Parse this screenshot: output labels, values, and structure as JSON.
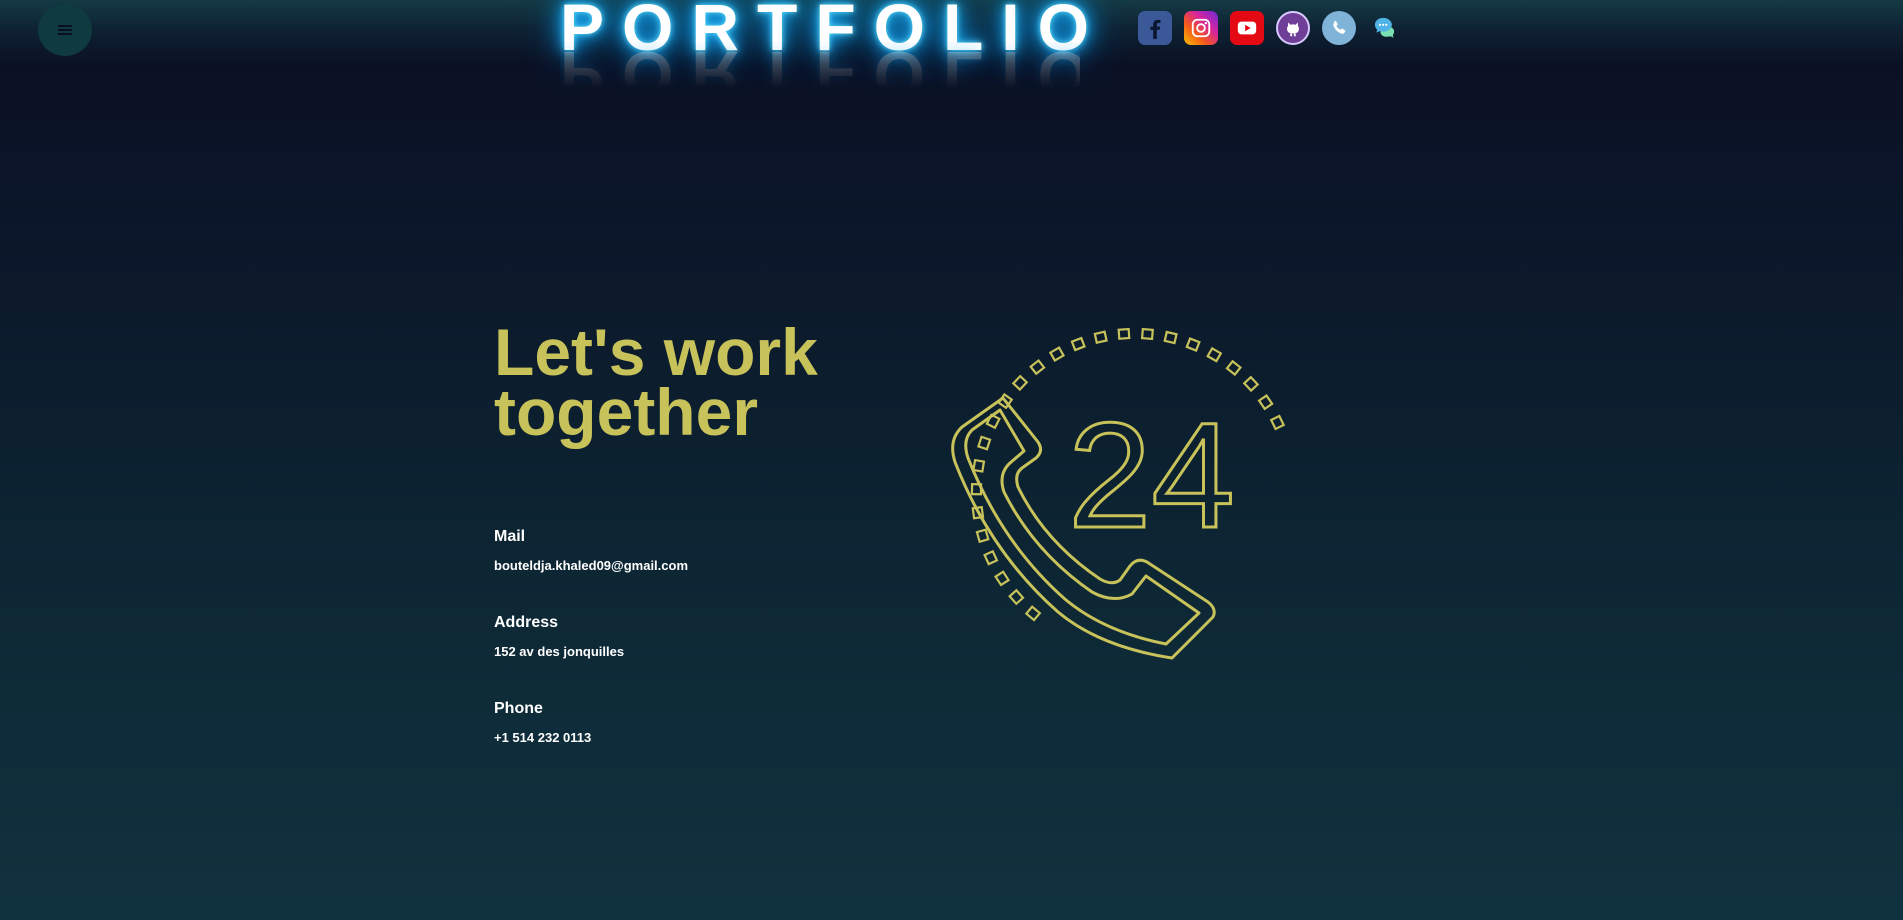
{
  "header": {
    "logo_text": "PORTFOLIO",
    "menu_icon": "hamburger-icon",
    "social": [
      {
        "name": "facebook",
        "icon": "facebook-icon",
        "color": "#3b5998"
      },
      {
        "name": "instagram",
        "icon": "instagram-icon",
        "color": "#d6249f"
      },
      {
        "name": "youtube",
        "icon": "youtube-icon",
        "color": "#e50914"
      },
      {
        "name": "github",
        "icon": "github-icon",
        "color": "#6f3f97"
      },
      {
        "name": "phone",
        "icon": "phone-icon",
        "color": "#7fb4d8"
      },
      {
        "name": "chat",
        "icon": "chat-icon",
        "color": "#4fb3e6"
      }
    ]
  },
  "main": {
    "headline_line1": "Let's work",
    "headline_line2": "together",
    "accent_color": "#c8c25a",
    "contacts": [
      {
        "label": "Mail",
        "value": "bouteldja.khaled09@gmail.com"
      },
      {
        "label": "Address",
        "value": "152 av des jonquilles"
      },
      {
        "label": "Phone",
        "value": "+1 514 232 0113"
      }
    ],
    "illustration": {
      "icon": "phone-24-icon",
      "digits": "24"
    }
  }
}
